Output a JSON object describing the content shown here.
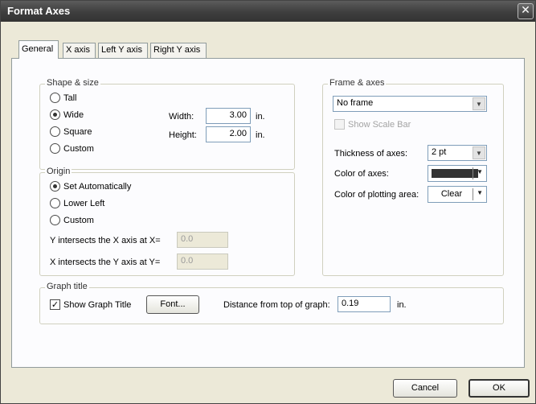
{
  "window": {
    "title": "Format Axes",
    "close_glyph": "✕"
  },
  "tabs": [
    {
      "label": "General",
      "active": true
    },
    {
      "label": "X axis",
      "active": false
    },
    {
      "label": "Left Y axis",
      "active": false
    },
    {
      "label": "Right Y axis",
      "active": false
    }
  ],
  "shape_size": {
    "legend": "Shape & size",
    "options": [
      "Tall",
      "Wide",
      "Square",
      "Custom"
    ],
    "selected": "Wide",
    "width_label": "Width:",
    "width_value": "3.00",
    "height_label": "Height:",
    "height_value": "2.00",
    "unit": "in."
  },
  "origin": {
    "legend": "Origin",
    "options": [
      "Set Automatically",
      "Lower Left",
      "Custom"
    ],
    "selected": "Set Automatically",
    "y_intersect_label": "Y intersects the X axis at X=",
    "y_intersect_value": "0.0",
    "x_intersect_label": "X intersects the Y axis at Y=",
    "x_intersect_value": "0.0"
  },
  "frame_axes": {
    "legend": "Frame & axes",
    "frame_value": "No frame",
    "show_scale_bar": "Show Scale Bar",
    "thickness_label": "Thickness of axes:",
    "thickness_value": "2 pt",
    "color_axes_label": "Color of axes:",
    "color_axes_value": "#333333",
    "plot_area_label": "Color of plotting area:",
    "plot_area_value": "Clear"
  },
  "graph_title": {
    "legend": "Graph title",
    "show_label": "Show Graph Title",
    "show_checked": true,
    "font_button": "Font...",
    "distance_label": "Distance from top of graph:",
    "distance_value": "0.19",
    "unit": "in."
  },
  "buttons": {
    "cancel": "Cancel",
    "ok": "OK"
  },
  "icons": {
    "dropdown": "▼",
    "check": "✓",
    "close": "close-icon"
  }
}
